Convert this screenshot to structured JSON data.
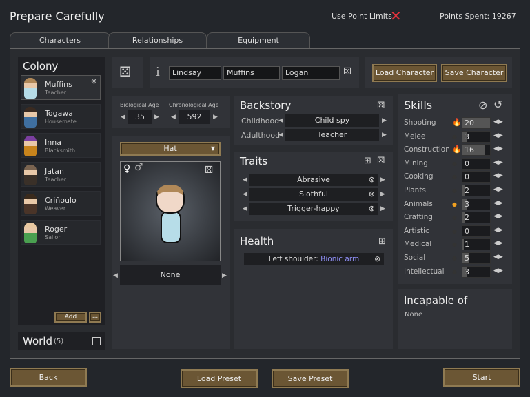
{
  "header": {
    "title": "Prepare Carefully",
    "point_limits_label": "Use Point Limits",
    "point_limits_icon": "close-x-icon",
    "points_spent": "Points Spent: 19267"
  },
  "tabs": [
    {
      "label": "Characters"
    },
    {
      "label": "Relationships"
    },
    {
      "label": "Equipment"
    }
  ],
  "colony": {
    "title": "Colony",
    "pawns": [
      {
        "name": "Muffins",
        "job": "Teacher",
        "color": "#b7dde8",
        "hair": "#b08858"
      },
      {
        "name": "Togawa",
        "job": "Housemate",
        "color": "#3f6fa0",
        "hair": "#3a2a20"
      },
      {
        "name": "Inna",
        "job": "Blacksmith",
        "color": "#c8841c",
        "hair": "#7b3fa0"
      },
      {
        "name": "Jatan",
        "job": "Teacher",
        "color": "#3a3028",
        "hair": "#7a6450"
      },
      {
        "name": "Criñoulo",
        "job": "Weaver",
        "color": "#4a3428",
        "hair": "#3a2a1c"
      },
      {
        "name": "Roger",
        "job": "Sailor",
        "color": "#4aa050",
        "hair": "#e8c8a0"
      }
    ],
    "add_label": "Add",
    "more_label": "..."
  },
  "world": {
    "label": "World",
    "count": "(5)"
  },
  "name": {
    "first": "Lindsay",
    "nick": "Muffins",
    "last": "Logan"
  },
  "buttons": {
    "load_character": "Load Character",
    "save_character": "Save Character",
    "back": "Back",
    "load_preset": "Load Preset",
    "save_preset": "Save Preset",
    "start": "Start"
  },
  "age": {
    "bio_label": "Biological Age",
    "bio": "35",
    "chrono_label": "Chronological Age",
    "chrono": "592"
  },
  "apparel": {
    "layer": "Hat",
    "item": "None"
  },
  "backstory": {
    "title": "Backstory",
    "childhood_label": "Childhood",
    "childhood": "Child spy",
    "adulthood_label": "Adulthood",
    "adulthood": "Teacher"
  },
  "traits": {
    "title": "Traits",
    "items": [
      "Abrasive",
      "Slothful",
      "Trigger-happy"
    ]
  },
  "health": {
    "title": "Health",
    "items": [
      {
        "part": "Left shoulder:",
        "condition": "Bionic arm"
      }
    ]
  },
  "skills": {
    "title": "Skills",
    "items": [
      {
        "name": "Shooting",
        "level": "20",
        "passion": 2
      },
      {
        "name": "Melee",
        "level": "3",
        "passion": 0
      },
      {
        "name": "Construction",
        "level": "16",
        "passion": 2
      },
      {
        "name": "Mining",
        "level": "0",
        "passion": 0
      },
      {
        "name": "Cooking",
        "level": "0",
        "passion": 0
      },
      {
        "name": "Plants",
        "level": "2",
        "passion": 0
      },
      {
        "name": "Animals",
        "level": "3",
        "passion": 1
      },
      {
        "name": "Crafting",
        "level": "2",
        "passion": 0
      },
      {
        "name": "Artistic",
        "level": "0",
        "passion": 0
      },
      {
        "name": "Medical",
        "level": "1",
        "passion": 0
      },
      {
        "name": "Social",
        "level": "5",
        "passion": 0
      },
      {
        "name": "Intellectual",
        "level": "3",
        "passion": 0
      }
    ]
  },
  "incapable": {
    "title": "Incapable of",
    "value": "None"
  },
  "colors": {
    "button": "#6b5634",
    "bionic": "#8c8cf0",
    "x_icon": "#e0323c",
    "flame": "#f0a020"
  }
}
